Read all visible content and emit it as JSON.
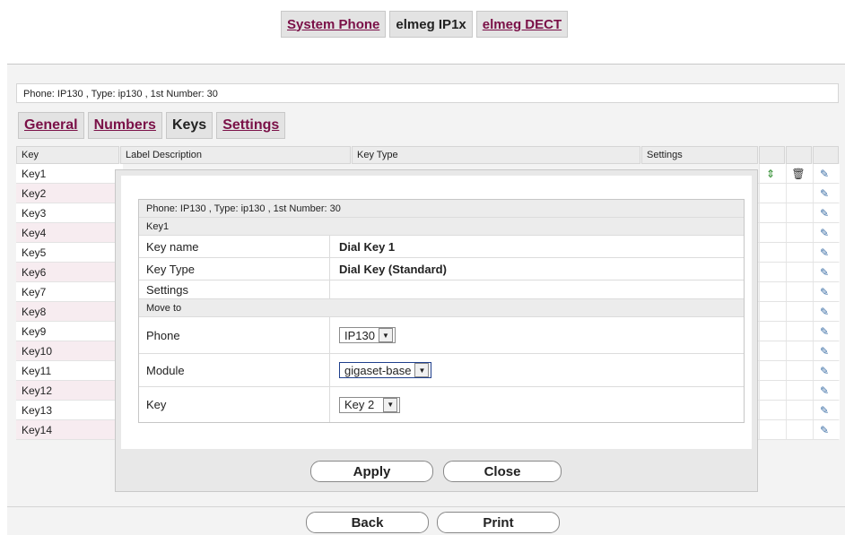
{
  "topnav": [
    {
      "label": "System Phone",
      "link": true
    },
    {
      "label": "elmeg IP1x",
      "link": false
    },
    {
      "label": "elmeg DECT",
      "link": true
    }
  ],
  "info_line": "Phone: IP130 , Type: ip130 , 1st Number: 30",
  "subtabs": [
    {
      "label": "General",
      "link": true
    },
    {
      "label": "Numbers",
      "link": true
    },
    {
      "label": "Keys",
      "link": false
    },
    {
      "label": "Settings",
      "link": true
    }
  ],
  "table": {
    "headers": {
      "key": "Key",
      "label": "Label Description",
      "type": "Key Type",
      "settings": "Settings"
    },
    "rows": [
      "Key1",
      "Key2",
      "Key3",
      "Key4",
      "Key5",
      "Key6",
      "Key7",
      "Key8",
      "Key9",
      "Key10",
      "Key11",
      "Key12",
      "Key13",
      "Key14"
    ]
  },
  "modal": {
    "info_line": "Phone: IP130 , Type: ip130 , 1st Number: 30",
    "section_key": "Key1",
    "key_name_label": "Key name",
    "key_name_value": "Dial Key 1",
    "key_type_label": "Key Type",
    "key_type_value": "Dial Key (Standard)",
    "settings_label": "Settings",
    "move_to_label": "Move to",
    "phone_label": "Phone",
    "phone_value": "IP130",
    "module_label": "Module",
    "module_value": "gigaset-base",
    "key_label": "Key",
    "key_value": "Key 2",
    "apply_label": "Apply",
    "close_label": "Close"
  },
  "footer": {
    "back_label": "Back",
    "print_label": "Print"
  },
  "icons": {
    "row1": [
      "move-up-down-icon",
      "delete-icon",
      "edit-icon"
    ],
    "rows": "edit-icon"
  }
}
